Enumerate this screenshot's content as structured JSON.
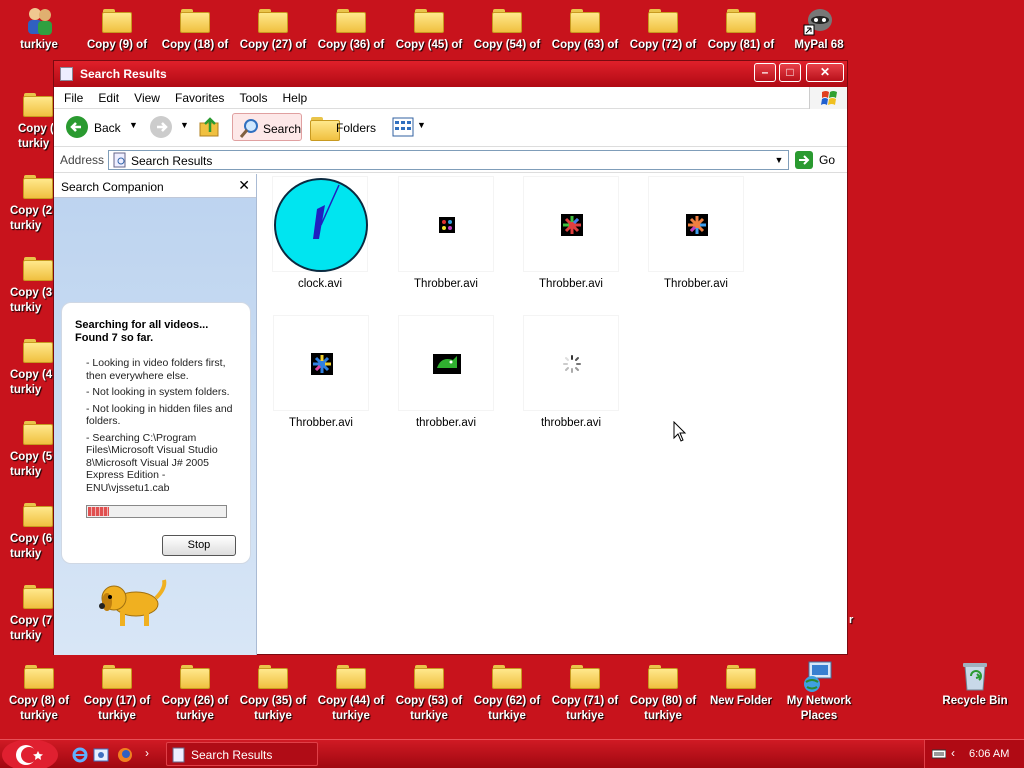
{
  "desktop": {
    "top_row": [
      "turkiye",
      "Copy (9) of",
      "Copy (18) of",
      "Copy (27) of",
      "Copy (36) of",
      "Copy (45) of",
      "Copy (54) of",
      "Copy (63) of",
      "Copy (72) of",
      "Copy (81) of",
      "MyPal 68"
    ],
    "left_col": [
      "Copy (",
      "Copy (2",
      "Copy (3",
      "Copy (4",
      "Copy (5",
      "Copy (6",
      "Copy (7"
    ],
    "left_col_sub": "turkiy",
    "bottom_row": [
      {
        "l1": "Copy (8) of",
        "l2": "turkiye"
      },
      {
        "l1": "Copy (17) of",
        "l2": "turkiye"
      },
      {
        "l1": "Copy (26) of",
        "l2": "turkiye"
      },
      {
        "l1": "Copy (35) of",
        "l2": "turkiye"
      },
      {
        "l1": "Copy (44) of",
        "l2": "turkiye"
      },
      {
        "l1": "Copy (53) of",
        "l2": "turkiye"
      },
      {
        "l1": "Copy (62) of",
        "l2": "turkiye"
      },
      {
        "l1": "Copy (71) of",
        "l2": "turkiye"
      },
      {
        "l1": "Copy (80) of",
        "l2": "turkiye"
      },
      {
        "l1": "New Folder",
        "l2": ""
      },
      {
        "l1": "My Network",
        "l2": "Places"
      }
    ],
    "recycle_bin": "Recycle Bin",
    "right_edge_partial": "r"
  },
  "window": {
    "title": "Search Results",
    "menu": [
      "File",
      "Edit",
      "View",
      "Favorites",
      "Tools",
      "Help"
    ],
    "toolbar": {
      "back": "Back",
      "search": "Search",
      "folders": "Folders"
    },
    "address": {
      "label": "Address",
      "value": "Search Results",
      "go": "Go"
    }
  },
  "companion": {
    "title": "Search Companion",
    "status": "Searching for all videos... Found 7 so far.",
    "notes": [
      "- Looking in video folders first, then everywhere else.",
      "- Not looking in system folders.",
      "- Not looking in hidden files and folders.",
      "- Searching C:\\Program Files\\Microsoft Visual Studio 8\\Microsoft Visual J# 2005 Express Edition - ENU\\vjssetu1.cab"
    ],
    "progress_fraction": 0.15,
    "stop": "Stop"
  },
  "results": [
    {
      "name": "clock.avi"
    },
    {
      "name": "Throbber.avi"
    },
    {
      "name": "Throbber.avi"
    },
    {
      "name": "Throbber.avi"
    },
    {
      "name": "Throbber.avi"
    },
    {
      "name": "throbber.avi"
    },
    {
      "name": "throbber.avi"
    }
  ],
  "taskbar": {
    "task": "Search Results",
    "clock": "6:06 AM"
  },
  "colors": {
    "desktop": "#c8131c",
    "titlebar": "#c8101a",
    "clock_face": "#00e5f0"
  }
}
